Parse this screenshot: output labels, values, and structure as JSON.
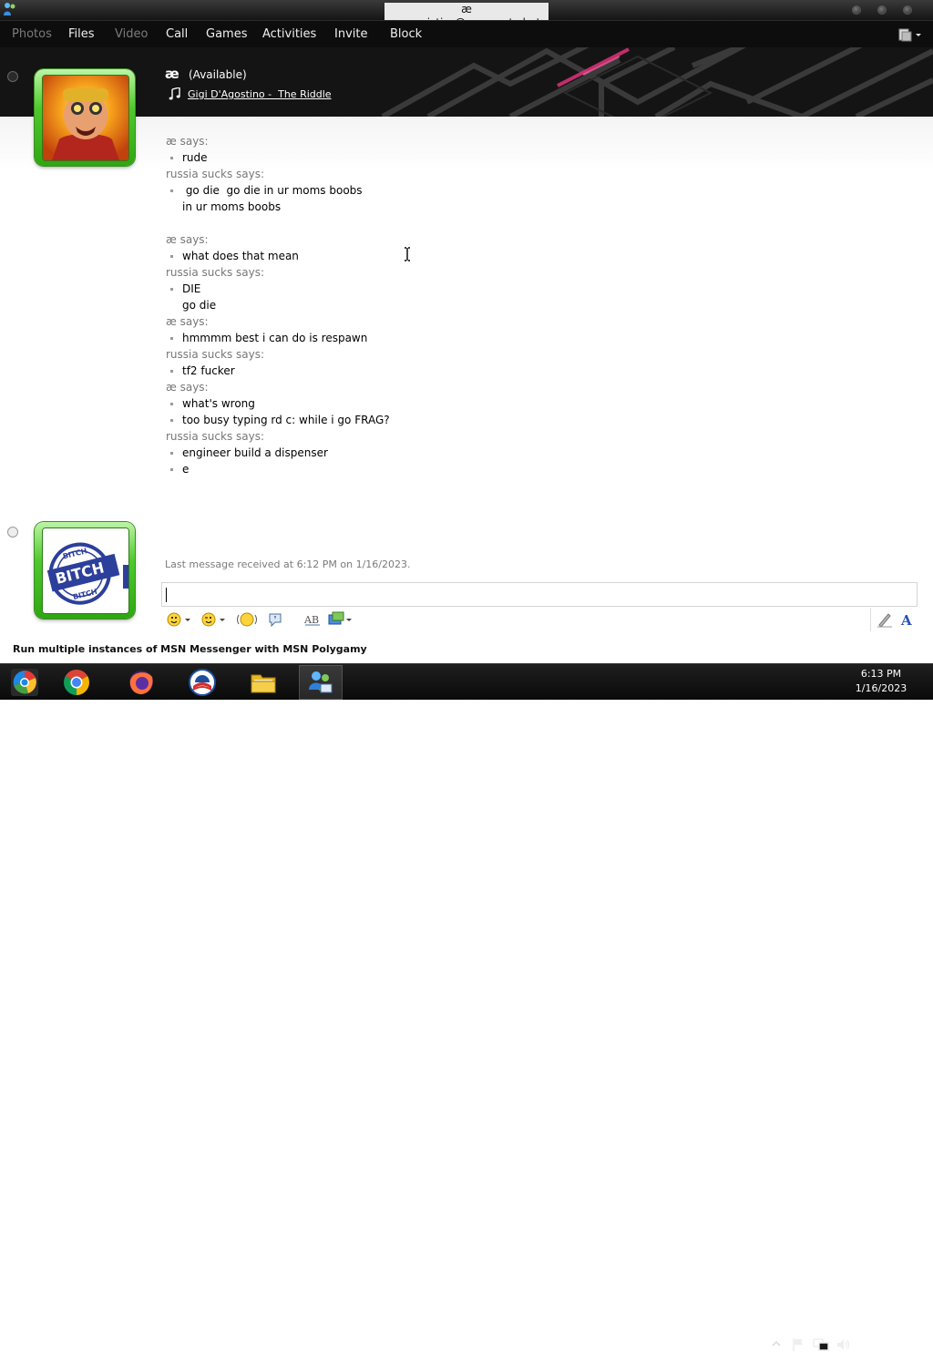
{
  "window": {
    "title": "æ <energistics@escargot.chat>"
  },
  "menu": {
    "items": [
      {
        "label": "Photos",
        "enabled": false
      },
      {
        "label": "Files",
        "enabled": true
      },
      {
        "label": "Video",
        "enabled": false
      },
      {
        "label": "Call",
        "enabled": true
      },
      {
        "label": "Games",
        "enabled": true
      },
      {
        "label": "Activities",
        "enabled": true
      },
      {
        "label": "Invite",
        "enabled": true
      },
      {
        "label": "Block",
        "enabled": true
      }
    ]
  },
  "contact": {
    "name": "æ",
    "status": "(Available)",
    "now_playing": "Gigi D'Agostino -  The Riddle"
  },
  "conversation": [
    {
      "sender": "æ says:",
      "lines": [
        {
          "text": "rude",
          "bullet": true
        }
      ]
    },
    {
      "sender": "russia sucks says:",
      "lines": [
        {
          "text": " go die  go die in ur moms boobs",
          "bullet": true
        },
        {
          "text": "in ur moms boobs",
          "bullet": false
        },
        {
          "text": "",
          "bullet": false
        }
      ]
    },
    {
      "sender": "æ says:",
      "lines": [
        {
          "text": "what does that mean",
          "bullet": true
        }
      ]
    },
    {
      "sender": "russia sucks says:",
      "lines": [
        {
          "text": "DIE",
          "bullet": true
        },
        {
          "text": "go die",
          "bullet": false
        }
      ]
    },
    {
      "sender": "æ says:",
      "lines": [
        {
          "text": "hmmmm best i can do is respawn",
          "bullet": true
        }
      ]
    },
    {
      "sender": "russia sucks says:",
      "lines": [
        {
          "text": "tf2 fucker",
          "bullet": true
        }
      ]
    },
    {
      "sender": "æ says:",
      "lines": [
        {
          "text": "what's wrong",
          "bullet": true
        },
        {
          "text": "too busy typing rd c: while i go FRAG?",
          "bullet": true
        }
      ]
    },
    {
      "sender": "russia sucks says:",
      "lines": [
        {
          "text": "engineer build a dispenser",
          "bullet": true
        },
        {
          "text": "e",
          "bullet": true
        }
      ]
    }
  ],
  "footer": {
    "last_message": "Last message received at 6:12 PM on 1/16/2023.",
    "input_value": "",
    "promo": "Run multiple instances of MSN Messenger with MSN Polygamy"
  },
  "user_avatar": {
    "stamp_top": "BITCH",
    "stamp_main": "BITCH",
    "stamp_bottom": "BITCH"
  },
  "taskbar": {
    "apps": [
      {
        "name": "chrome-os-icon",
        "active": false
      },
      {
        "name": "chrome-icon",
        "active": false
      },
      {
        "name": "firefox-icon",
        "active": false
      },
      {
        "name": "obama-logo-icon",
        "active": false
      },
      {
        "name": "file-explorer-icon",
        "active": false
      },
      {
        "name": "msn-messenger-icon",
        "active": true
      }
    ],
    "time": "6:13 PM",
    "date": "1/16/2023"
  }
}
